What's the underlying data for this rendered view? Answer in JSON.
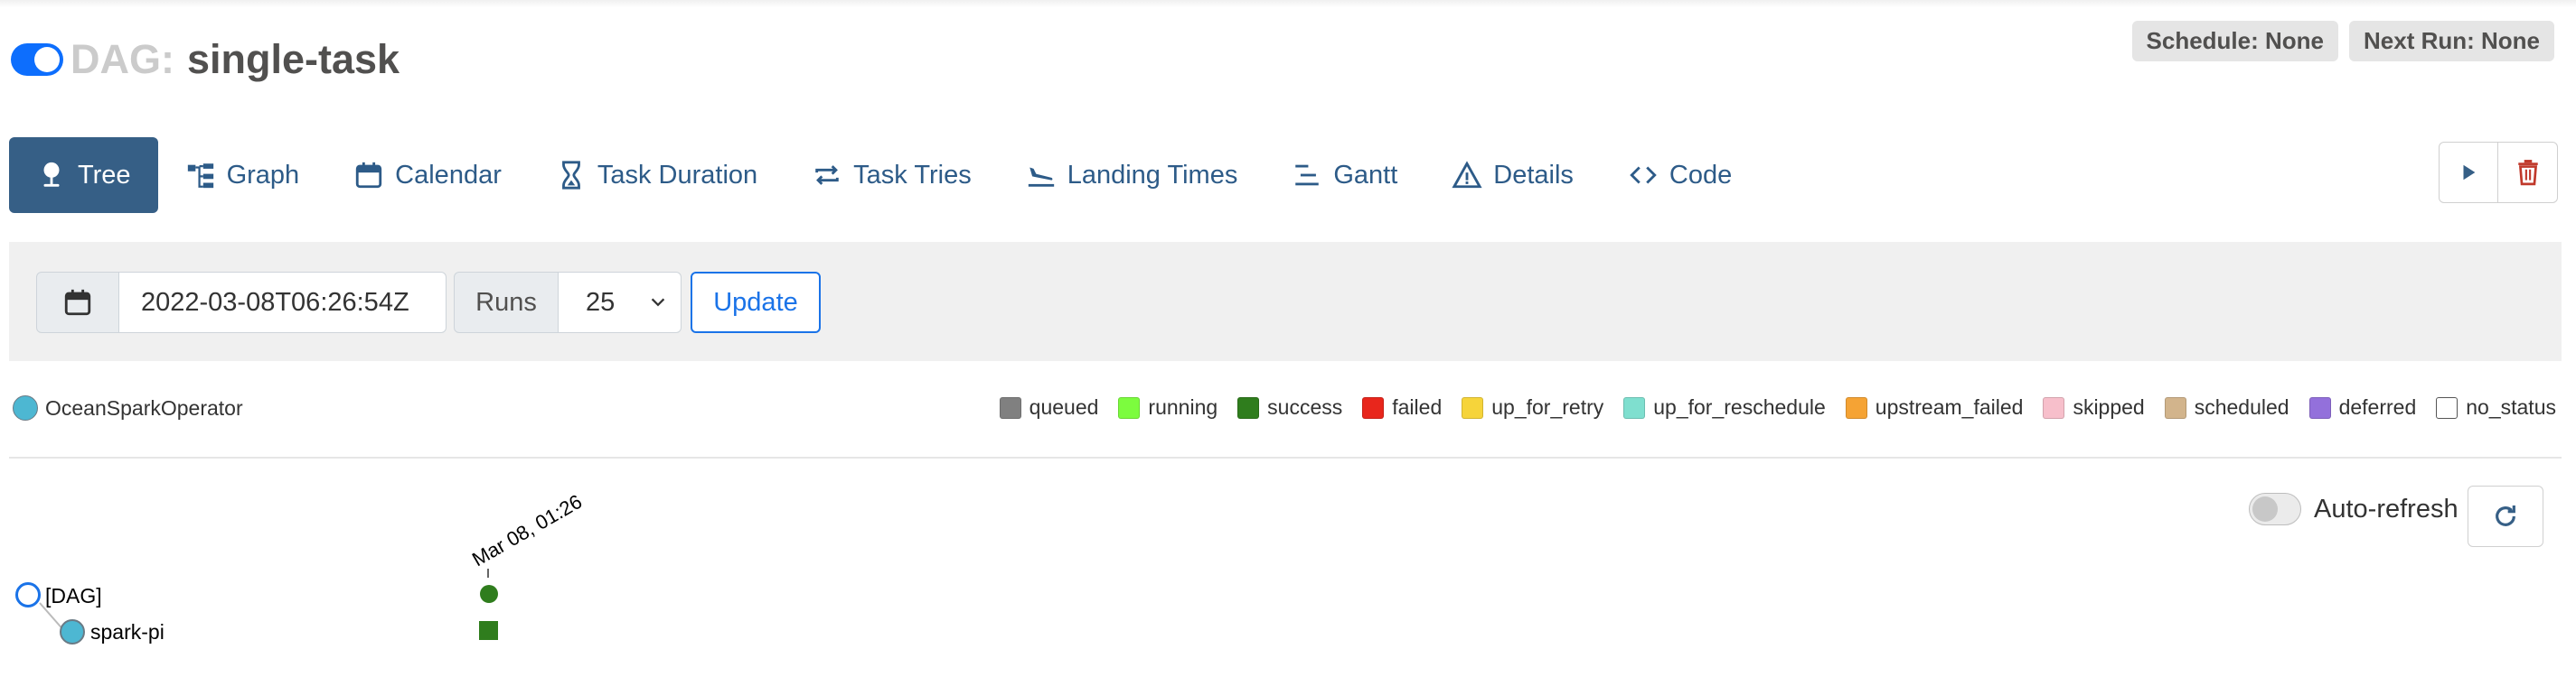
{
  "header": {
    "dag_prefix": "DAG:",
    "dag_name": "single-task",
    "schedule_badge": "Schedule: None",
    "next_run_badge": "Next Run: None"
  },
  "tabs": [
    {
      "label": "Tree",
      "icon": "tree-icon",
      "active": true
    },
    {
      "label": "Graph",
      "icon": "graph-icon"
    },
    {
      "label": "Calendar",
      "icon": "calendar-icon"
    },
    {
      "label": "Task Duration",
      "icon": "hourglass-icon"
    },
    {
      "label": "Task Tries",
      "icon": "retry-icon"
    },
    {
      "label": "Landing Times",
      "icon": "plane-landing-icon"
    },
    {
      "label": "Gantt",
      "icon": "gantt-icon"
    },
    {
      "label": "Details",
      "icon": "warning-triangle-icon"
    },
    {
      "label": "Code",
      "icon": "code-icon"
    }
  ],
  "controls": {
    "base_date": "2022-03-08T06:26:54Z",
    "runs_label": "Runs",
    "runs_value": "25",
    "update_label": "Update"
  },
  "operator": {
    "label": "OceanSparkOperator",
    "color": "#4db7d2"
  },
  "legend": [
    {
      "label": "queued",
      "color": "#808080"
    },
    {
      "label": "running",
      "color": "#7cfc3e"
    },
    {
      "label": "success",
      "color": "#2f7d1d"
    },
    {
      "label": "failed",
      "color": "#e8261c"
    },
    {
      "label": "up_for_retry",
      "color": "#f6d43a"
    },
    {
      "label": "up_for_reschedule",
      "color": "#7fdfcf"
    },
    {
      "label": "upstream_failed",
      "color": "#f5a334"
    },
    {
      "label": "skipped",
      "color": "#f7bfcb"
    },
    {
      "label": "scheduled",
      "color": "#d2b48c"
    },
    {
      "label": "deferred",
      "color": "#9370db"
    },
    {
      "label": "no_status",
      "color": "#ffffff"
    }
  ],
  "autorefresh": {
    "label": "Auto-refresh",
    "enabled": false
  },
  "tree": {
    "run_label": "Mar 08, 01:26",
    "dag_node": "[DAG]",
    "task_node": "spark-pi",
    "run_state_color": "#2f7d1d",
    "task_state_color": "#2f7d1d"
  },
  "colors": {
    "accent": "#365f86",
    "link": "#2d5b88",
    "update": "#1a73e8",
    "delete": "#c0392b"
  }
}
